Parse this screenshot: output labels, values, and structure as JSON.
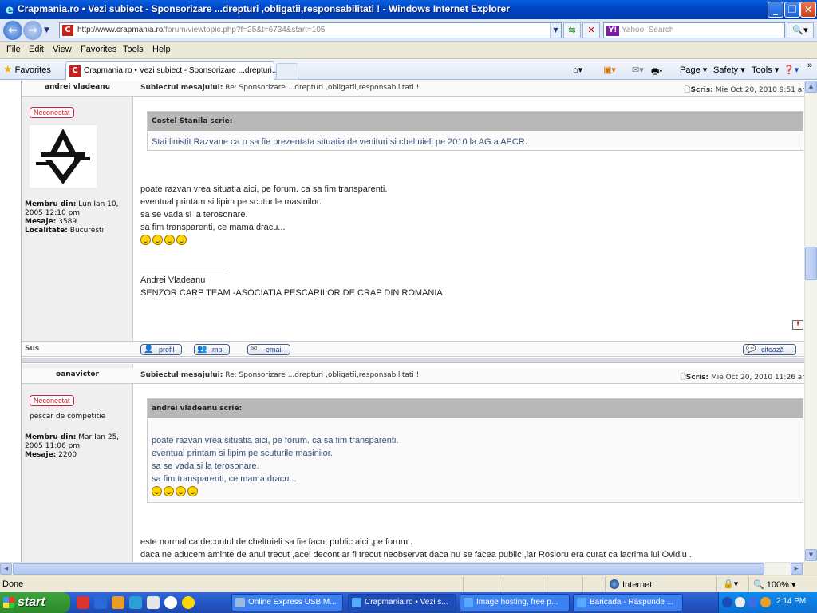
{
  "window": {
    "title": "Crapmania.ro • Vezi subiect - Sponsorizare ...drepturi ,obligatii,responsabilitati ! - Windows Internet Explorer",
    "url_domain": "http://www.crapmania.ro",
    "url_path": "/forum/viewtopic.php?f=25&t=6734&start=105",
    "search_placeholder": "Yahoo! Search"
  },
  "menu": [
    "File",
    "Edit",
    "View",
    "Favorites",
    "Tools",
    "Help"
  ],
  "favorites_label": "Favorites",
  "tab_label": "Crapmania.ro • Vezi subiect - Sponsorizare ...drepturi...",
  "commands": {
    "page": "Page",
    "safety": "Safety",
    "tools": "Tools"
  },
  "posts": [
    {
      "author": "andrei vladeanu",
      "subject_label": "Subiectul mesajului:",
      "subject": "Re: Sponsorizare ...drepturi ,obligatii,responsabilitati !",
      "date_label": "Scris:",
      "date": "Mie Oct 20, 2010 9:51 ar",
      "status": "Neconectat",
      "member_since_label": "Membru din:",
      "member_since": "Lun Ian 10, 2005 12:10 pm",
      "posts_label": "Mesaje:",
      "posts": "3589",
      "location_label": "Localitate:",
      "location": "Bucuresti",
      "quote_author": "Costel Stanila scrie:",
      "quote_text": "Stai linistit Razvane ca o sa fie prezentata situatia de venituri si cheltuieli pe 2010 la AG a APCR.",
      "body": [
        "poate razvan vrea situatia aici, pe forum. ca sa fim transparenti.",
        "eventual printam si lipim pe scuturile masinilor.",
        "sa se vada si la terosonare.",
        "sa fim transparenti, ce mama dracu..."
      ],
      "signature": [
        "Andrei Vladeanu",
        "SENZOR CARP TEAM -ASOCIATIA PESCARILOR DE CRAP DIN ROMANIA"
      ],
      "back_top": "Sus",
      "buttons": {
        "profile": "profil",
        "pm": "mp",
        "email": "email",
        "quote": "citează"
      }
    },
    {
      "author": "oanavictor",
      "subject_label": "Subiectul mesajului:",
      "subject": "Re: Sponsorizare ...drepturi ,obligatii,responsabilitati !",
      "date_label": "Scris:",
      "date": "Mie Oct 20, 2010 11:26 ar",
      "status": "Neconectat",
      "rank": "pescar de competitie",
      "member_since_label": "Membru din:",
      "member_since": "Mar Ian 25, 2005 11:06 pm",
      "posts_label": "Mesaje:",
      "posts": "2200",
      "quote_author": "andrei vladeanu scrie:",
      "quote_body": [
        "poate razvan vrea situatia aici, pe forum. ca sa fim transparenti.",
        "eventual printam si lipim pe scuturile masinilor.",
        "sa se vada si la terosonare.",
        "sa fim transparenti, ce mama dracu..."
      ],
      "body": [
        "este normal ca decontul de cheltuieli sa fie facut public aici ,pe forum .",
        "daca ne aducem aminte de anul trecut ,acel decont ar fi trecut neobservat daca nu se facea public ,iar Rosioru era curat ca lacrima lui Ovidiu ."
      ]
    }
  ],
  "status": {
    "done": "Done",
    "zone": "Internet",
    "zoom": "100%"
  },
  "taskbar": {
    "start": "start",
    "tasks": [
      "Online Express USB M...",
      "Crapmania.ro • Vezi s...",
      "Image hosting, free p...",
      "Baricada - Răspunde ..."
    ],
    "time": "2:14 PM"
  }
}
